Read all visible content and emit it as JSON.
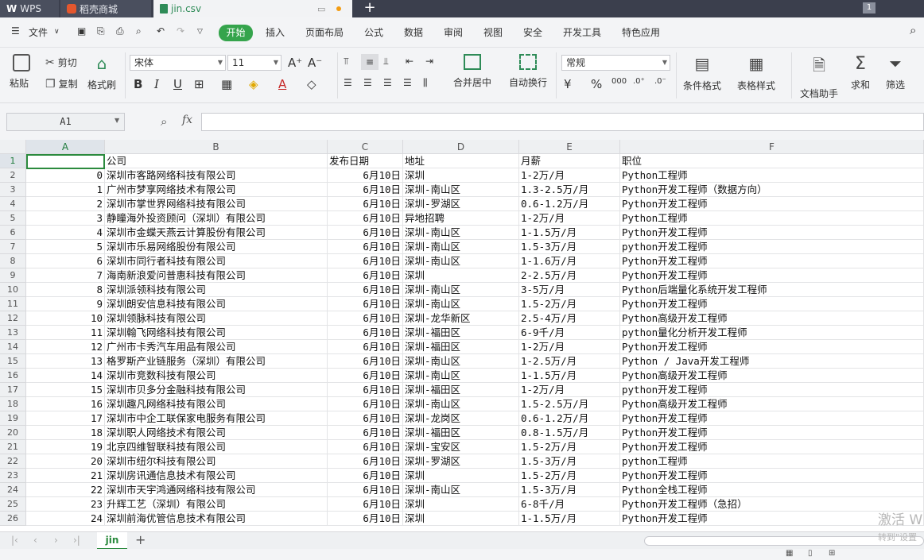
{
  "app_tabs": [
    {
      "label": "WPS",
      "icon": "wps-logo-icon"
    },
    {
      "label": "稻壳商城",
      "icon": "docer-icon"
    },
    {
      "label": "jin.csv",
      "icon": "spreadsheet-file-icon"
    }
  ],
  "window_count": "1",
  "menu": {
    "file": "文件",
    "items": [
      "开始",
      "插入",
      "页面布局",
      "公式",
      "数据",
      "审阅",
      "视图",
      "安全",
      "开发工具",
      "特色应用"
    ]
  },
  "ribbon": {
    "paste": "粘贴",
    "cut": "剪切",
    "copy": "复制",
    "format_painter": "格式刷",
    "font_name": "宋体",
    "font_size": "11",
    "merge_center": "合并居中",
    "wrap_text": "自动换行",
    "number_format": "常规",
    "conditional_format": "条件格式",
    "table_style": "表格样式",
    "doc_assistant": "文档助手",
    "sum": "求和",
    "filter": "筛选",
    "percent": "%",
    "thousands": "000"
  },
  "formula_bar": {
    "name_box": "A1",
    "fx": "fx",
    "value": ""
  },
  "columns": [
    "A",
    "B",
    "C",
    "D",
    "E",
    "F"
  ],
  "header_row": [
    "",
    "公司",
    "发布日期",
    "地址",
    "月薪",
    "职位"
  ],
  "rows": [
    [
      "0",
      "深圳市客路网络科技有限公司",
      "6月10日",
      "深圳",
      "1-2万/月",
      "Python工程师"
    ],
    [
      "1",
      "广州市梦享网络技术有限公司",
      "6月10日",
      "深圳-南山区",
      "1.3-2.5万/月",
      "Python开发工程师（数据方向）"
    ],
    [
      "2",
      "深圳市掌世界网络科技有限公司",
      "6月10日",
      "深圳-罗湖区",
      "0.6-1.2万/月",
      "Python开发工程师"
    ],
    [
      "3",
      "静瞳海外投资顾问（深圳）有限公司",
      "6月10日",
      "异地招聘",
      "1-2万/月",
      "Python工程师"
    ],
    [
      "4",
      "深圳市金蝶天燕云计算股份有限公司",
      "6月10日",
      "深圳-南山区",
      "1-1.5万/月",
      "Python开发工程师"
    ],
    [
      "5",
      "深圳市乐易网络股份有限公司",
      "6月10日",
      "深圳-南山区",
      "1.5-3万/月",
      "python开发工程师"
    ],
    [
      "6",
      "深圳市同行者科技有限公司",
      "6月10日",
      "深圳-南山区",
      "1-1.6万/月",
      "Python开发工程师"
    ],
    [
      "7",
      "海南新浪爱问普惠科技有限公司",
      "6月10日",
      "深圳",
      "2-2.5万/月",
      "Python开发工程师"
    ],
    [
      "8",
      "深圳派领科技有限公司",
      "6月10日",
      "深圳-南山区",
      "3-5万/月",
      "Python后端量化系统开发工程师"
    ],
    [
      "9",
      "深圳朗安信息科技有限公司",
      "6月10日",
      "深圳-南山区",
      "1.5-2万/月",
      "Python开发工程师"
    ],
    [
      "10",
      "深圳领脉科技有限公司",
      "6月10日",
      "深圳-龙华新区",
      "2.5-4万/月",
      "Python高级开发工程师"
    ],
    [
      "11",
      "深圳翰飞网络科技有限公司",
      "6月10日",
      "深圳-福田区",
      "6-9千/月",
      "python量化分析开发工程师"
    ],
    [
      "12",
      "广州市卡秀汽车用品有限公司",
      "6月10日",
      "深圳-福田区",
      "1-2万/月",
      "Python开发工程师"
    ],
    [
      "13",
      "格罗斯产业链服务（深圳）有限公司",
      "6月10日",
      "深圳-南山区",
      "1-2.5万/月",
      "Python / Java开发工程师"
    ],
    [
      "14",
      "深圳市竞数科技有限公司",
      "6月10日",
      "深圳-南山区",
      "1-1.5万/月",
      "Python高级开发工程师"
    ],
    [
      "15",
      "深圳市贝多分金融科技有限公司",
      "6月10日",
      "深圳-福田区",
      "1-2万/月",
      "python开发工程师"
    ],
    [
      "16",
      "深圳趣凡网络科技有限公司",
      "6月10日",
      "深圳-南山区",
      "1.5-2.5万/月",
      "Python高级开发工程师"
    ],
    [
      "17",
      "深圳市中企工联保家电服务有限公司",
      "6月10日",
      "深圳-龙岗区",
      "0.6-1.2万/月",
      "Python开发工程师"
    ],
    [
      "18",
      "深圳职人网络技术有限公司",
      "6月10日",
      "深圳-福田区",
      "0.8-1.5万/月",
      "Python开发工程师"
    ],
    [
      "19",
      "北京四维智联科技有限公司",
      "6月10日",
      "深圳-宝安区",
      "1.5-2万/月",
      "Python开发工程师"
    ],
    [
      "20",
      "深圳市纽尔科技有限公司",
      "6月10日",
      "深圳-罗湖区",
      "1.5-3万/月",
      "python工程师"
    ],
    [
      "21",
      "深圳房讯通信息技术有限公司",
      "6月10日",
      "深圳",
      "1.5-2万/月",
      "Python开发工程师"
    ],
    [
      "22",
      "深圳市天宇鸿通网络科技有限公司",
      "6月10日",
      "深圳-南山区",
      "1.5-3万/月",
      "Python全栈工程师"
    ],
    [
      "23",
      "升辉工艺（深圳）有限公司",
      "6月10日",
      "深圳",
      "6-8千/月",
      "Python开发工程师（急招）"
    ],
    [
      "24",
      "深圳前海优管信息技术有限公司",
      "6月10日",
      "深圳",
      "1-1.5万/月",
      "Python开发工程师"
    ]
  ],
  "sheet_tab": "jin",
  "watermark": {
    "line1": "激活 W",
    "line2": "转到\"设置"
  }
}
